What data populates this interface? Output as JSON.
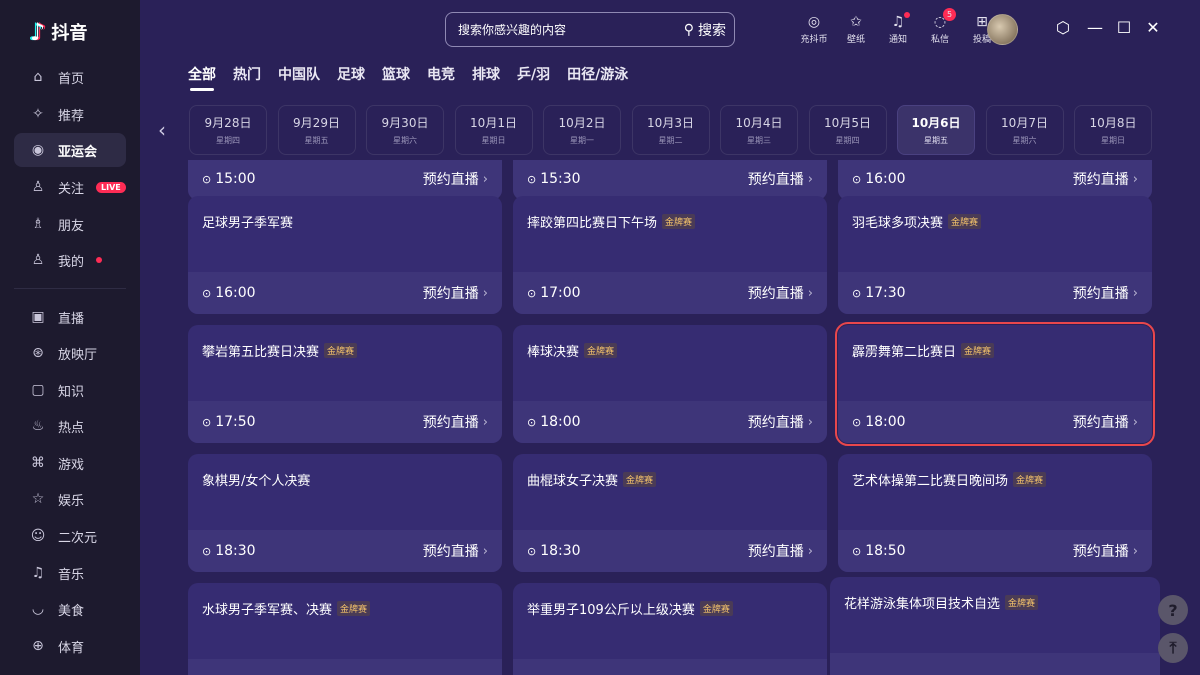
{
  "app": {
    "name": "抖音"
  },
  "sidebar": {
    "items": [
      {
        "label": "首页",
        "icon": "home-icon",
        "glyph": "⌂"
      },
      {
        "label": "推荐",
        "icon": "sparkle-icon",
        "glyph": "✧"
      },
      {
        "label": "亚运会",
        "icon": "games-icon",
        "glyph": "◉",
        "active": true
      },
      {
        "label": "关注",
        "icon": "follow-icon",
        "glyph": "♙",
        "badge": "LIVE"
      },
      {
        "label": "朋友",
        "icon": "friends-icon",
        "glyph": "♗"
      },
      {
        "label": "我的",
        "icon": "user-icon",
        "glyph": "♙",
        "dot": true
      },
      {
        "label": "直播",
        "icon": "tv-icon",
        "glyph": "▣"
      },
      {
        "label": "放映厅",
        "icon": "film-icon",
        "glyph": "⊛"
      },
      {
        "label": "知识",
        "icon": "knowledge-icon",
        "glyph": "▢"
      },
      {
        "label": "热点",
        "icon": "fire-icon",
        "glyph": "♨"
      },
      {
        "label": "游戏",
        "icon": "gamepad-icon",
        "glyph": "⌘"
      },
      {
        "label": "娱乐",
        "icon": "star-icon",
        "glyph": "☆"
      },
      {
        "label": "二次元",
        "icon": "ghost-icon",
        "glyph": "☺"
      },
      {
        "label": "音乐",
        "icon": "music-icon",
        "glyph": "♫"
      },
      {
        "label": "美食",
        "icon": "food-icon",
        "glyph": "◡"
      },
      {
        "label": "体育",
        "icon": "ball-icon",
        "glyph": "⊕"
      }
    ]
  },
  "search": {
    "placeholder": "搜索你感兴趣的内容",
    "button": "搜索"
  },
  "top_icons": [
    {
      "label": "充抖币",
      "icon": "coin-icon",
      "glyph": "◎"
    },
    {
      "label": "壁纸",
      "icon": "wallpaper-icon",
      "glyph": "✩"
    },
    {
      "label": "通知",
      "icon": "bell-icon",
      "glyph": "♫",
      "dot": true
    },
    {
      "label": "私信",
      "icon": "message-icon",
      "glyph": "◌",
      "count": "5"
    },
    {
      "label": "投稿",
      "icon": "upload-icon",
      "glyph": "⊞"
    }
  ],
  "window": {
    "settings": "⬡",
    "minimize": "—",
    "maximize": "☐",
    "close": "✕"
  },
  "categories": [
    "全部",
    "热门",
    "中国队",
    "足球",
    "篮球",
    "电竞",
    "排球",
    "乒/羽",
    "田径/游泳"
  ],
  "dates": [
    {
      "date": "9月28日",
      "weekday": "星期四"
    },
    {
      "date": "9月29日",
      "weekday": "星期五"
    },
    {
      "date": "9月30日",
      "weekday": "星期六"
    },
    {
      "date": "10月1日",
      "weekday": "星期日"
    },
    {
      "date": "10月2日",
      "weekday": "星期一"
    },
    {
      "date": "10月3日",
      "weekday": "星期二"
    },
    {
      "date": "10月4日",
      "weekday": "星期三"
    },
    {
      "date": "10月5日",
      "weekday": "星期四"
    },
    {
      "date": "10月6日",
      "weekday": "星期五",
      "active": true
    },
    {
      "date": "10月7日",
      "weekday": "星期六"
    },
    {
      "date": "10月8日",
      "weekday": "星期日"
    }
  ],
  "book_label": "预约直播",
  "gold_badge": "金牌赛",
  "top_row": [
    {
      "time": "15:00"
    },
    {
      "time": "15:30"
    },
    {
      "time": "16:00"
    }
  ],
  "events": [
    {
      "title": "足球男子季军赛",
      "time": "16:00",
      "gold": false
    },
    {
      "title": "摔跤第四比赛日下午场",
      "time": "17:00",
      "gold": true
    },
    {
      "title": "羽毛球多项决赛",
      "time": "17:30",
      "gold": true
    },
    {
      "title": "攀岩第五比赛日决赛",
      "time": "17:50",
      "gold": true
    },
    {
      "title": "棒球决赛",
      "time": "18:00",
      "gold": true
    },
    {
      "title": "霹雳舞第二比赛日",
      "time": "18:00",
      "gold": true,
      "highlight": true
    },
    {
      "title": "象棋男/女个人决赛",
      "time": "18:30",
      "gold": false
    },
    {
      "title": "曲棍球女子决赛",
      "time": "18:30",
      "gold": true
    },
    {
      "title": "艺术体操第二比赛日晚间场",
      "time": "18:50",
      "gold": true
    },
    {
      "title": "水球男子季军赛、决赛",
      "time": "",
      "gold": true
    },
    {
      "title": "举重男子109公斤以上级决赛",
      "time": "",
      "gold": true
    },
    {
      "title": "花样游泳集体项目技术自选",
      "time": "",
      "gold": true
    }
  ],
  "float": {
    "help": "?",
    "top": "⤒"
  }
}
